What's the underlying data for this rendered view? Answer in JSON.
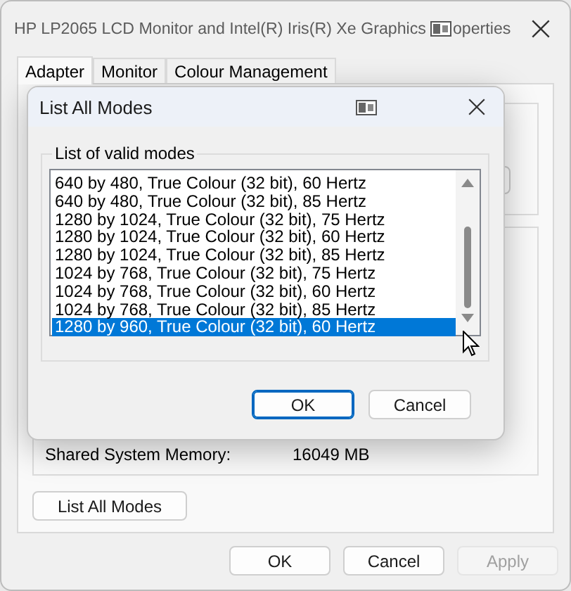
{
  "window": {
    "title": "HP LP2065 LCD Monitor and Intel(R) Iris(R) Xe Graphics",
    "title_end": "operties"
  },
  "tabs": [
    {
      "label": "Adapter",
      "selected": true
    },
    {
      "label": "Monitor",
      "selected": false
    },
    {
      "label": "Colour Management",
      "selected": false
    }
  ],
  "adapter_panel": {
    "memory_label": "Shared System Memory:",
    "memory_value": "16049 MB",
    "list_button": "List All Modes"
  },
  "buttons": [
    {
      "label": "OK",
      "disabled": false
    },
    {
      "label": "Cancel",
      "disabled": false
    },
    {
      "label": "Apply",
      "disabled": true
    }
  ],
  "dialog": {
    "title": "List All Modes",
    "group_label": "List of valid modes",
    "modes": [
      {
        "label": "640 by 480, True Colour (32 bit), 60 Hertz",
        "selected": false
      },
      {
        "label": "640 by 480, True Colour (32 bit), 85 Hertz",
        "selected": false
      },
      {
        "label": "1280 by 1024, True Colour (32 bit), 75 Hertz",
        "selected": false
      },
      {
        "label": "1280 by 1024, True Colour (32 bit), 60 Hertz",
        "selected": false
      },
      {
        "label": "1280 by 1024, True Colour (32 bit), 85 Hertz",
        "selected": false
      },
      {
        "label": "1024 by 768, True Colour (32 bit), 75 Hertz",
        "selected": false
      },
      {
        "label": "1024 by 768, True Colour (32 bit), 60 Hertz",
        "selected": false
      },
      {
        "label": "1024 by 768, True Colour (32 bit), 85 Hertz",
        "selected": false
      },
      {
        "label": "1280 by 960, True Colour (32 bit), 60 Hertz",
        "selected": true
      }
    ],
    "buttons": [
      {
        "label": "OK",
        "default": true
      },
      {
        "label": "Cancel",
        "default": false
      }
    ]
  }
}
